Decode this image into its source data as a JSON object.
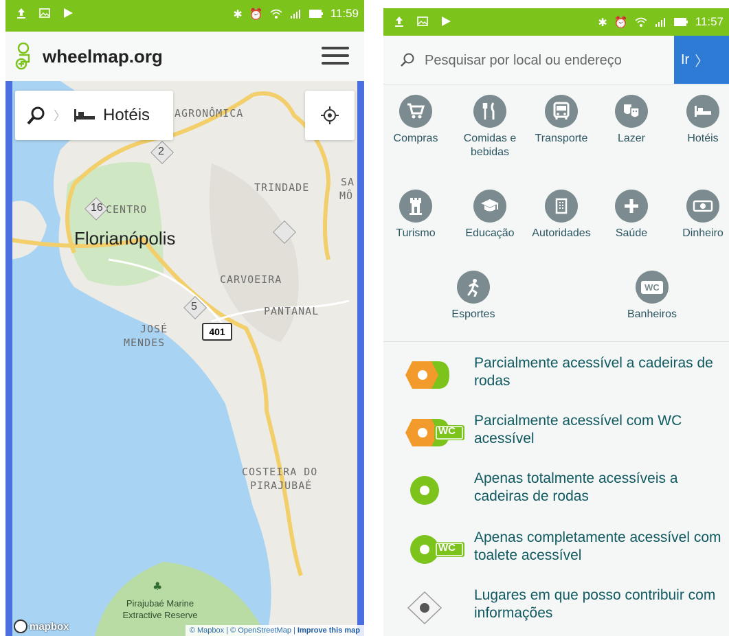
{
  "left": {
    "status_time": "11:59",
    "brand": "wheelmap.org",
    "search_pill_label": "Hotéis",
    "map_labels": {
      "agronomica": "AGRONÔMICA",
      "trindade": "TRINDADE",
      "sa": "SA",
      "mo": "MÔ",
      "centro": "CENTRO",
      "carvoeira": "CARVOEIRA",
      "pantanal": "PANTANAL",
      "jose": "JOSÉ",
      "mendes": "MENDES",
      "costeira1": "COSTEIRA DO",
      "costeira2": "PIRAJUBAÉ",
      "city": "Florianópolis",
      "route": "401",
      "reserve1": "Pirajubaé Marine",
      "reserve2": "Extractive Reserve"
    },
    "clusters": [
      "2",
      "16",
      "5"
    ],
    "attribution": "© Mapbox | © OpenStreetMap | ",
    "attribution_link": "Improve this map",
    "mapbox_label": "mapbox"
  },
  "right": {
    "status_time": "11:57",
    "search_placeholder": "Pesquisar por local ou endereço",
    "go_label": "Ir",
    "categories": [
      {
        "label": "Compras",
        "icon": "shopping-cart-icon"
      },
      {
        "label": "Comidas e bebidas",
        "icon": "fork-knife-icon"
      },
      {
        "label": "Transporte",
        "icon": "bus-icon"
      },
      {
        "label": "Lazer",
        "icon": "theater-masks-icon"
      },
      {
        "label": "Hotéis",
        "icon": "bed-icon"
      },
      {
        "label": "Turismo",
        "icon": "tower-icon"
      },
      {
        "label": "Educação",
        "icon": "graduation-cap-icon"
      },
      {
        "label": "Autoridades",
        "icon": "building-icon"
      },
      {
        "label": "Saúde",
        "icon": "plus-icon"
      },
      {
        "label": "Dinheiro",
        "icon": "money-icon"
      },
      {
        "label": "Esportes",
        "icon": "running-icon"
      },
      {
        "label": "Banheiros",
        "icon": "wc-icon"
      }
    ],
    "legend": [
      {
        "label": "Parcialmente acessível a cadeiras de rodas"
      },
      {
        "label": "Parcialmente acessível com WC acessível",
        "badge": "WC"
      },
      {
        "label": "Apenas totalmente acessíveis a cadeiras de rodas"
      },
      {
        "label": "Apenas completamente acessível com toalete acessível",
        "badge": "WC"
      },
      {
        "label": "Lugares em que posso contribuir com informações"
      }
    ],
    "colors": {
      "green": "#7cc31c",
      "orange": "#f39a2d",
      "blue": "#2d7bd4",
      "icon_grey": "#7b8b8f"
    }
  }
}
